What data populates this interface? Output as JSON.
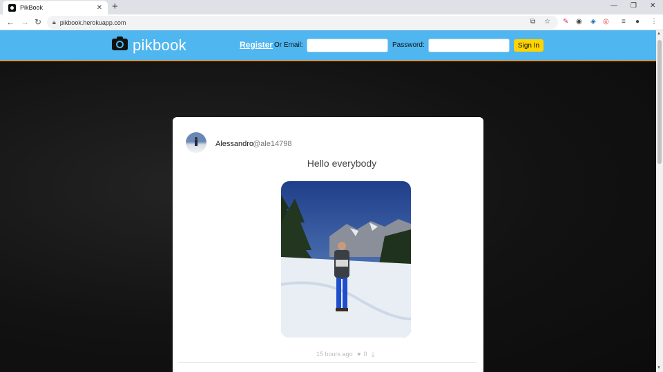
{
  "browser": {
    "tab_title": "PikBook",
    "tab_close": "✕",
    "new_tab": "+",
    "url": "pikbook.herokuapp.com",
    "controls": {
      "minimize": "—",
      "restore": "❐",
      "close": "✕"
    },
    "nav": {
      "back": "←",
      "forward": "→",
      "reload": "↻"
    }
  },
  "header": {
    "logo_text": "pikbook",
    "register_label": "Register",
    "or_email_label": "Or Email:",
    "password_label": "Password:",
    "signin_label": "Sign In",
    "accent_color": "#4fb6f0",
    "button_color": "#ffd400"
  },
  "post": {
    "author_name": "Alessandro",
    "author_handle": "@ale14798",
    "text": "Hello everybody",
    "time": "15 hours ago",
    "likes": "0"
  }
}
